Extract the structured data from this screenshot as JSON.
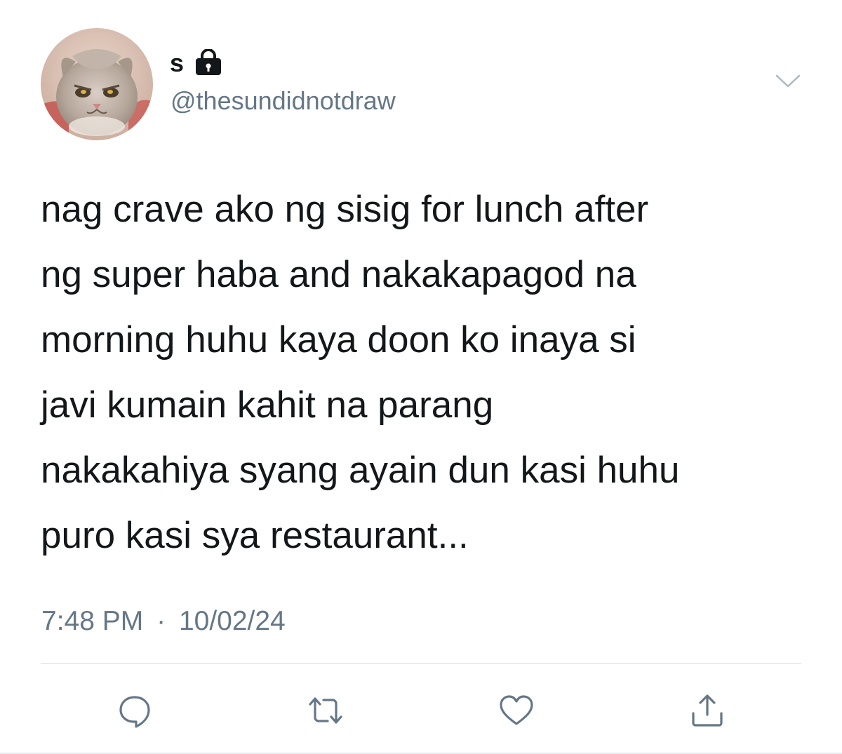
{
  "tweet": {
    "display_name": "s",
    "handle": "@thesundidnotdraw",
    "text_lines": [
      "nag crave ako ng sisig for lunch after",
      "ng super haba and nakakapagod na",
      "morning huhu kaya doon ko inaya si",
      "javi kumain kahit na parang",
      "nakakahiya syang ayain dun kasi huhu",
      "puro kasi sya restaurant..."
    ],
    "time": "7:48 PM",
    "separator": "·",
    "date": "10/02/24"
  },
  "icons": {
    "lock": "lock-icon",
    "menu": "chevron-down-icon",
    "reply": "reply-icon",
    "retweet": "retweet-icon",
    "like": "heart-icon",
    "share": "share-icon"
  },
  "colors": {
    "text": "#14171a",
    "secondary": "#657786",
    "divider": "#d6dce1"
  }
}
